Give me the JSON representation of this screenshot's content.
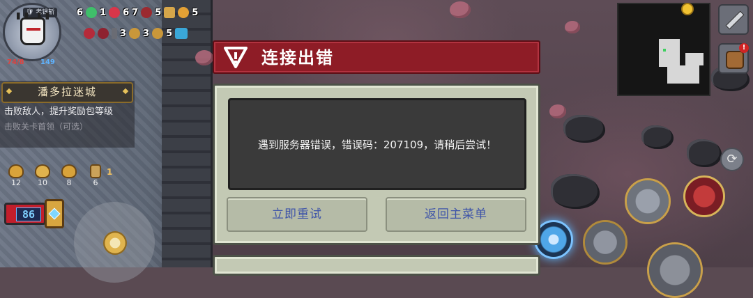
{
  "hud": {
    "player_badge": "🛡 老钱斩",
    "hp": "74/8",
    "mp": "149",
    "buffs_row1": [
      "6",
      "1",
      "6",
      "7",
      "5",
      "5"
    ],
    "buffs_row2": [
      "3",
      "3",
      "5"
    ]
  },
  "quest": {
    "title": "潘多拉迷城",
    "description": "击败敌人，提升奖励包等级",
    "optional": "击败关卡首领（可选）"
  },
  "consumables": [
    {
      "icon": "helmet-icon",
      "count": "12"
    },
    {
      "icon": "bell-icon",
      "count": "10"
    },
    {
      "icon": "helmet-icon",
      "count": "8"
    },
    {
      "icon": "shield-icon",
      "count": "6"
    }
  ],
  "consumable_extra": "1",
  "weapon": {
    "ammo": "86"
  },
  "dialog": {
    "title": "连接出错",
    "message": "遇到服务器错误，错误码：207109，请稍后尝试！",
    "retry_label": "立即重试",
    "menu_label": "返回主菜单"
  },
  "side": {
    "alert": "!",
    "swap_glyph": "⟳"
  },
  "colors": {
    "dialog_header": "#8e1c26",
    "dialog_body": "#c3c9b4",
    "button_text": "#3f55a8",
    "hp": "#e0423f",
    "mp": "#5fb3ff"
  }
}
